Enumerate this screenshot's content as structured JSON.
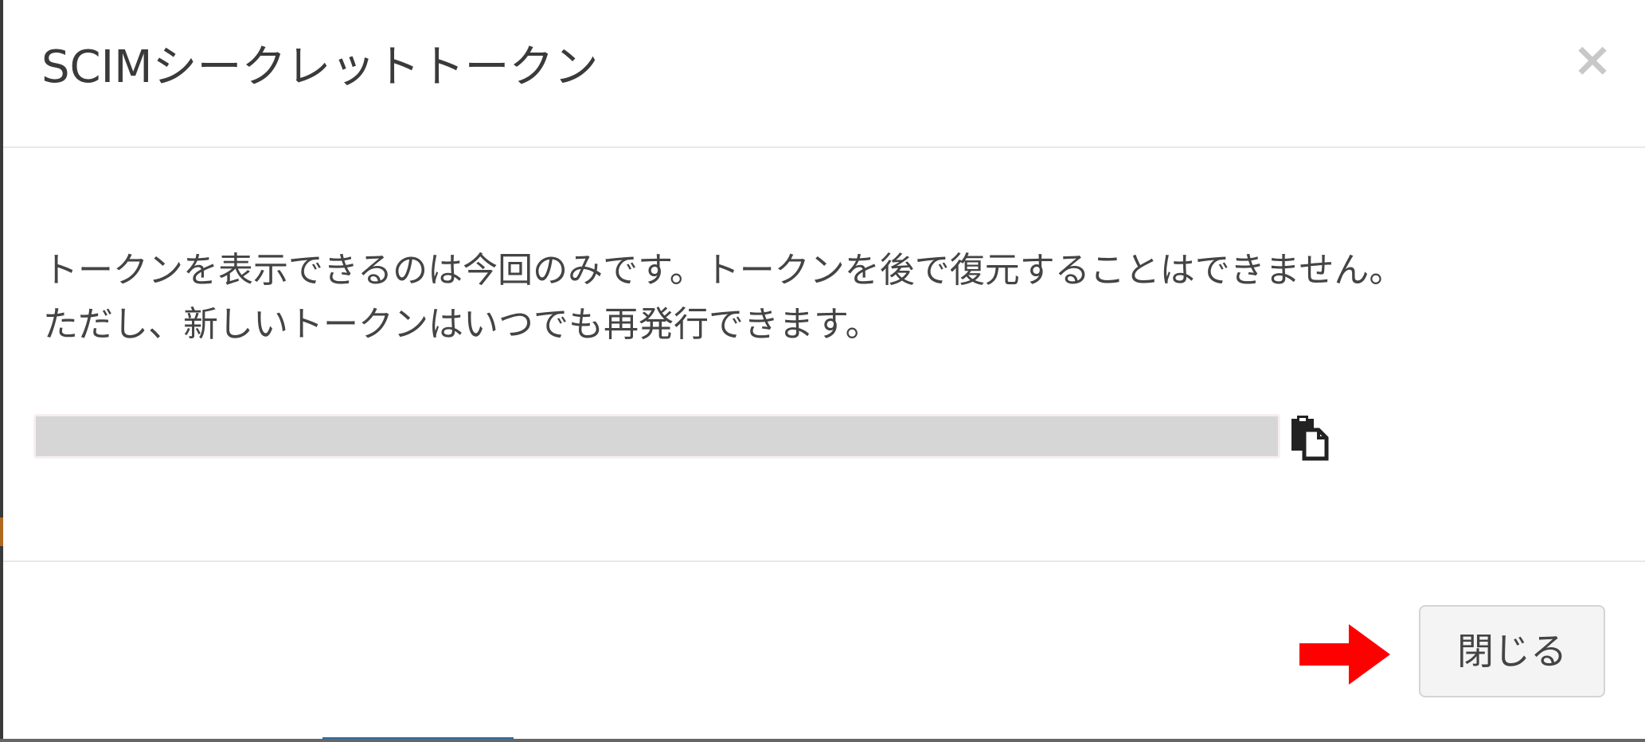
{
  "modal": {
    "title": "SCIMシークレットトークン",
    "close_glyph": "×",
    "message_line_1": "トークンを表示できるのは今回のみです。トークンを後で復元することはできません。",
    "message_line_2": "ただし、新しいトークンはいつでも再発行できます。",
    "token_value": "",
    "copy_icon": "clipboard-icon",
    "close_button_label": "閉じる"
  },
  "annotation": {
    "arrow_color": "#ff0000"
  }
}
